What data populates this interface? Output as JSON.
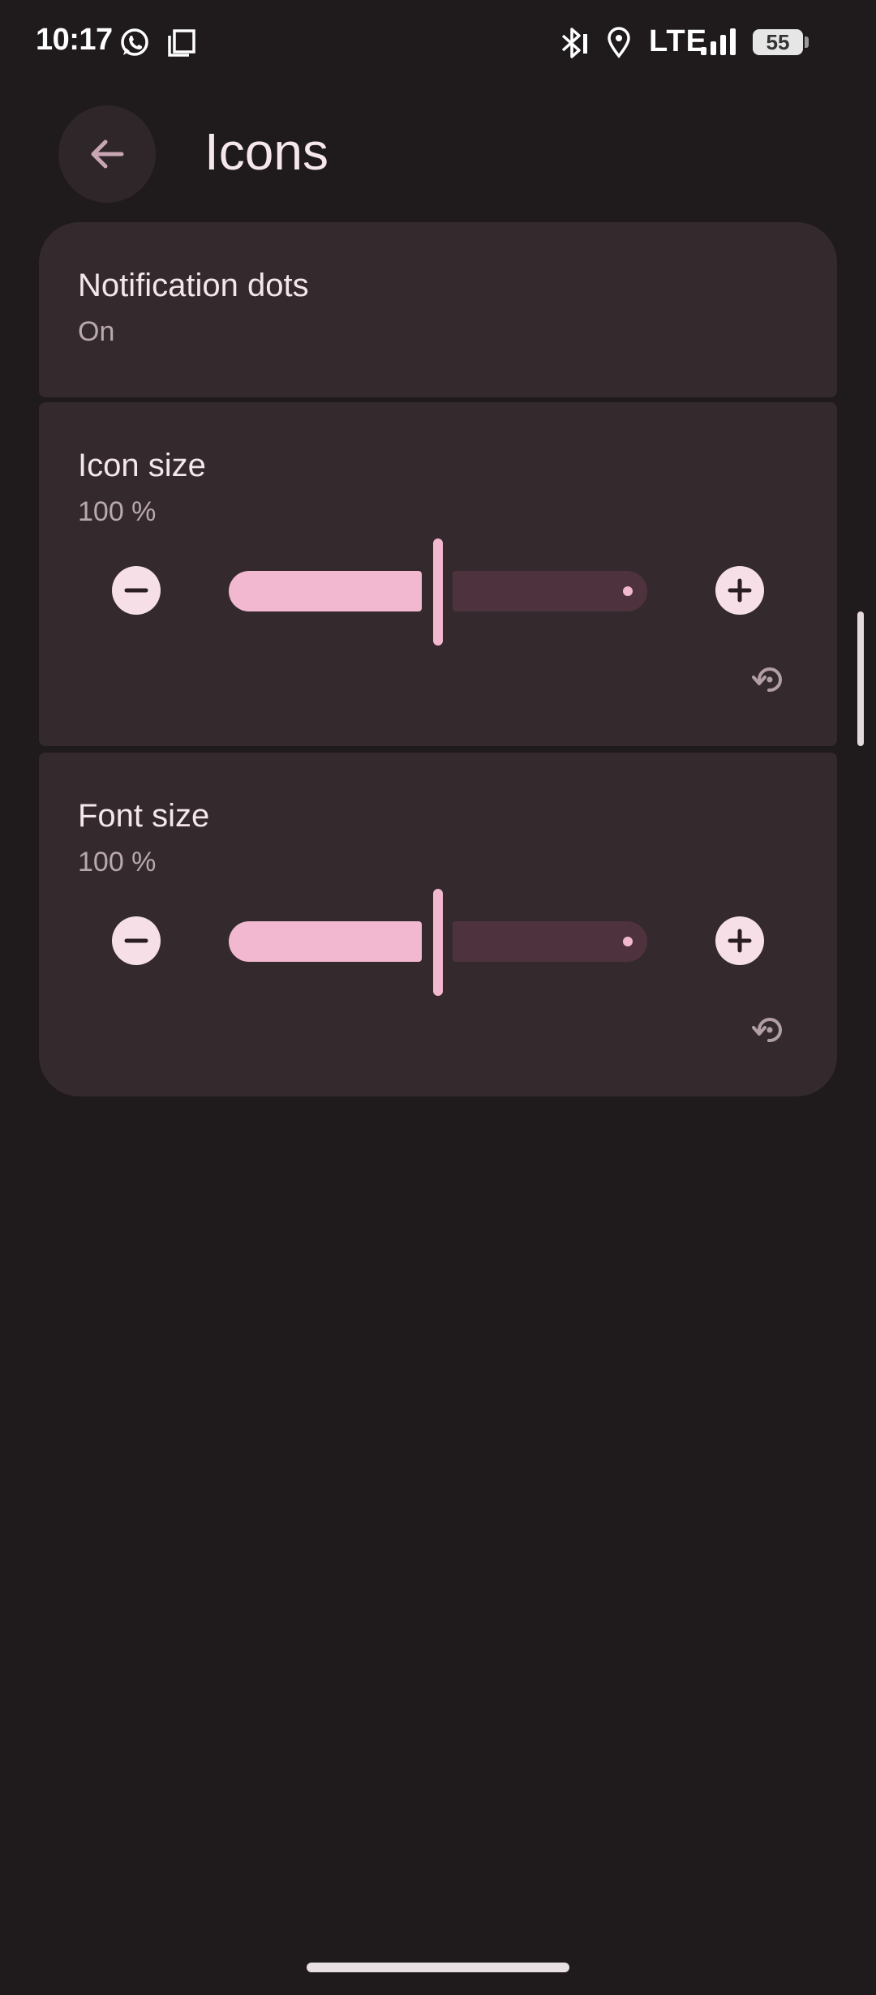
{
  "status_bar": {
    "time": "10:17",
    "network": "LTE",
    "battery": "55",
    "icons": [
      "whatsapp-icon",
      "screenshot-icon",
      "bluetooth-icon",
      "location-icon",
      "signal-icon",
      "battery-icon"
    ]
  },
  "app_bar": {
    "title": "Icons",
    "back_icon": "arrow-back-icon"
  },
  "settings": {
    "notification_dots": {
      "title": "Notification dots",
      "value": "On"
    },
    "icon_size": {
      "title": "Icon size",
      "value": "100 %",
      "slider_fraction": 0.5
    },
    "font_size": {
      "title": "Font size",
      "value": "100 %",
      "slider_fraction": 0.5
    }
  },
  "colors": {
    "background": "#1f1a1c",
    "card": "#342a2e",
    "accent": "#f2b8cf",
    "track_inactive": "#4e333e",
    "button_fill": "#f6dfe6"
  }
}
